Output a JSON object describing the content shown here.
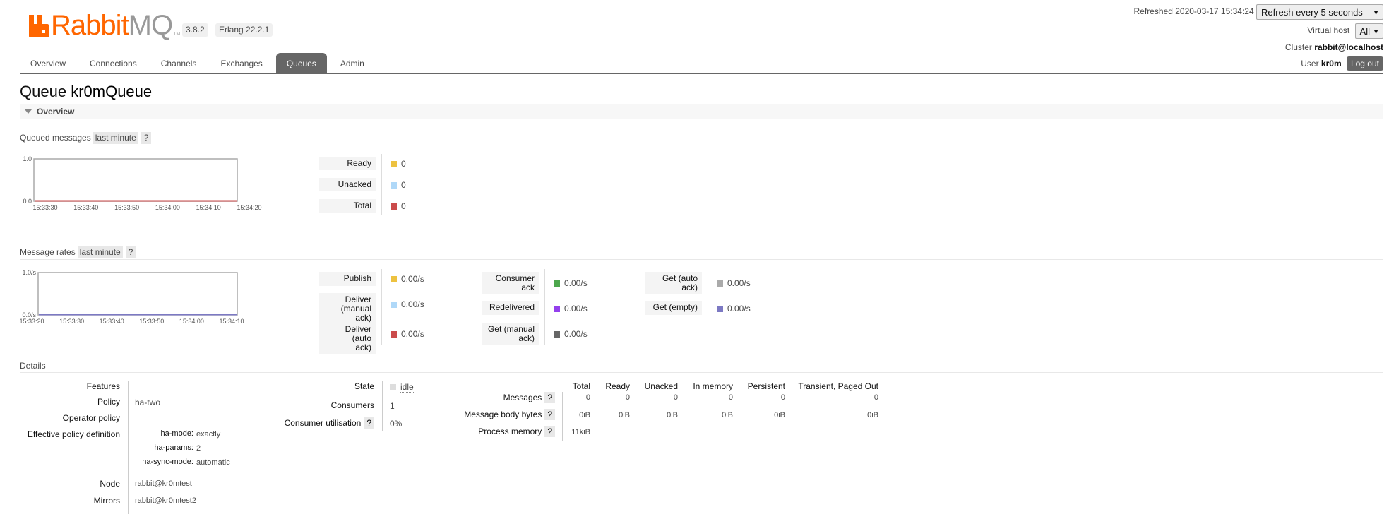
{
  "header": {
    "logo_rabbit": "Rabbit",
    "logo_mq": "MQ",
    "logo_tm": "TM",
    "version": "3.8.2",
    "erlang": "Erlang 22.2.1",
    "refreshed": "Refreshed 2020-03-17 15:34:24",
    "refresh_select": "Refresh every 5 seconds",
    "vhost_label": "Virtual host",
    "vhost_select": "All",
    "cluster_label": "Cluster",
    "cluster_name": "rabbit@localhost",
    "user_label": "User",
    "user_name": "kr0m",
    "logout": "Log out"
  },
  "tabs": [
    {
      "label": "Overview"
    },
    {
      "label": "Connections"
    },
    {
      "label": "Channels"
    },
    {
      "label": "Exchanges"
    },
    {
      "label": "Queues",
      "active": true
    },
    {
      "label": "Admin"
    }
  ],
  "title": {
    "prefix": "Queue",
    "name": "kr0mQueue"
  },
  "overview_section": "Overview",
  "queued": {
    "heading": "Queued messages",
    "range": "last minute",
    "help": "?",
    "legend": [
      {
        "label": "Ready",
        "value": "0",
        "color": "#edc240"
      },
      {
        "label": "Unacked",
        "value": "0",
        "color": "#afd8f8"
      },
      {
        "label": "Total",
        "value": "0",
        "color": "#cb4b4b"
      }
    ]
  },
  "rates": {
    "heading": "Message rates",
    "range": "last minute",
    "help": "?",
    "legend": [
      {
        "label": "Publish",
        "value": "0.00/s",
        "color": "#edc240"
      },
      {
        "label": "Deliver\n(manual ack)",
        "value": "0.00/s",
        "color": "#afd8f8"
      },
      {
        "label": "Deliver (auto\nack)",
        "value": "0.00/s",
        "color": "#cb4b4b"
      },
      {
        "label": "Consumer\nack",
        "value": "0.00/s",
        "color": "#4da74d"
      },
      {
        "label": "Redelivered",
        "value": "0.00/s",
        "color": "#9440ed"
      },
      {
        "label": "Get (manual\nack)",
        "value": "0.00/s",
        "color": "#666666"
      },
      {
        "label": "Get (auto\nack)",
        "value": "0.00/s",
        "color": "#aaaaaa"
      },
      {
        "label": "Get (empty)",
        "value": "0.00/s",
        "color": "#7c79c3"
      }
    ]
  },
  "chart_data": [
    {
      "type": "line",
      "x": [
        "15:33:30",
        "15:33:40",
        "15:33:50",
        "15:34:00",
        "15:34:10",
        "15:34:20"
      ],
      "ylim": [
        0,
        1
      ],
      "ytick_labels": [
        "0.0",
        "1.0"
      ],
      "series": [
        {
          "name": "Ready",
          "values": [
            0,
            0,
            0,
            0,
            0,
            0
          ]
        },
        {
          "name": "Unacked",
          "values": [
            0,
            0,
            0,
            0,
            0,
            0
          ]
        },
        {
          "name": "Total",
          "values": [
            0,
            0,
            0,
            0,
            0,
            0
          ]
        }
      ]
    },
    {
      "type": "line",
      "x": [
        "15:33:20",
        "15:33:30",
        "15:33:40",
        "15:33:50",
        "15:34:00",
        "15:34:10"
      ],
      "ylim": [
        0,
        1
      ],
      "ytick_labels": [
        "0.0/s",
        "1.0/s"
      ],
      "series": [
        {
          "name": "Publish",
          "values": [
            0,
            0,
            0,
            0,
            0,
            0
          ]
        },
        {
          "name": "Get (empty)",
          "values": [
            0,
            0,
            0,
            0,
            0,
            0
          ]
        }
      ]
    }
  ],
  "details": {
    "heading": "Details",
    "features_label": "Features",
    "policy_label": "Policy",
    "policy_value": "ha-two",
    "operator_policy_label": "Operator policy",
    "effective_label": "Effective policy definition",
    "effective": [
      {
        "key": "ha-mode:",
        "value": "exactly"
      },
      {
        "key": "ha-params:",
        "value": "2"
      },
      {
        "key": "ha-sync-mode:",
        "value": "automatic"
      }
    ],
    "node_label": "Node",
    "node_value": "rabbit@kr0mtest",
    "mirrors_label": "Mirrors",
    "mirrors_value": "rabbit@kr0mtest2",
    "state_label": "State",
    "state_value": "idle",
    "consumers_label": "Consumers",
    "consumers_value": "1",
    "utilisation_label": "Consumer utilisation",
    "utilisation_value": "0%",
    "help": "?",
    "stats": {
      "columns": [
        "Total",
        "Ready",
        "Unacked",
        "In memory",
        "Persistent",
        "Transient, Paged Out"
      ],
      "rows": [
        {
          "label": "Messages",
          "values": [
            "0",
            "0",
            "0",
            "0",
            "0",
            "0"
          ]
        },
        {
          "label": "Message body bytes",
          "values": [
            "0iB",
            "0iB",
            "0iB",
            "0iB",
            "0iB",
            "0iB"
          ]
        },
        {
          "label": "Process memory",
          "values": [
            "11kiB"
          ]
        }
      ]
    }
  }
}
